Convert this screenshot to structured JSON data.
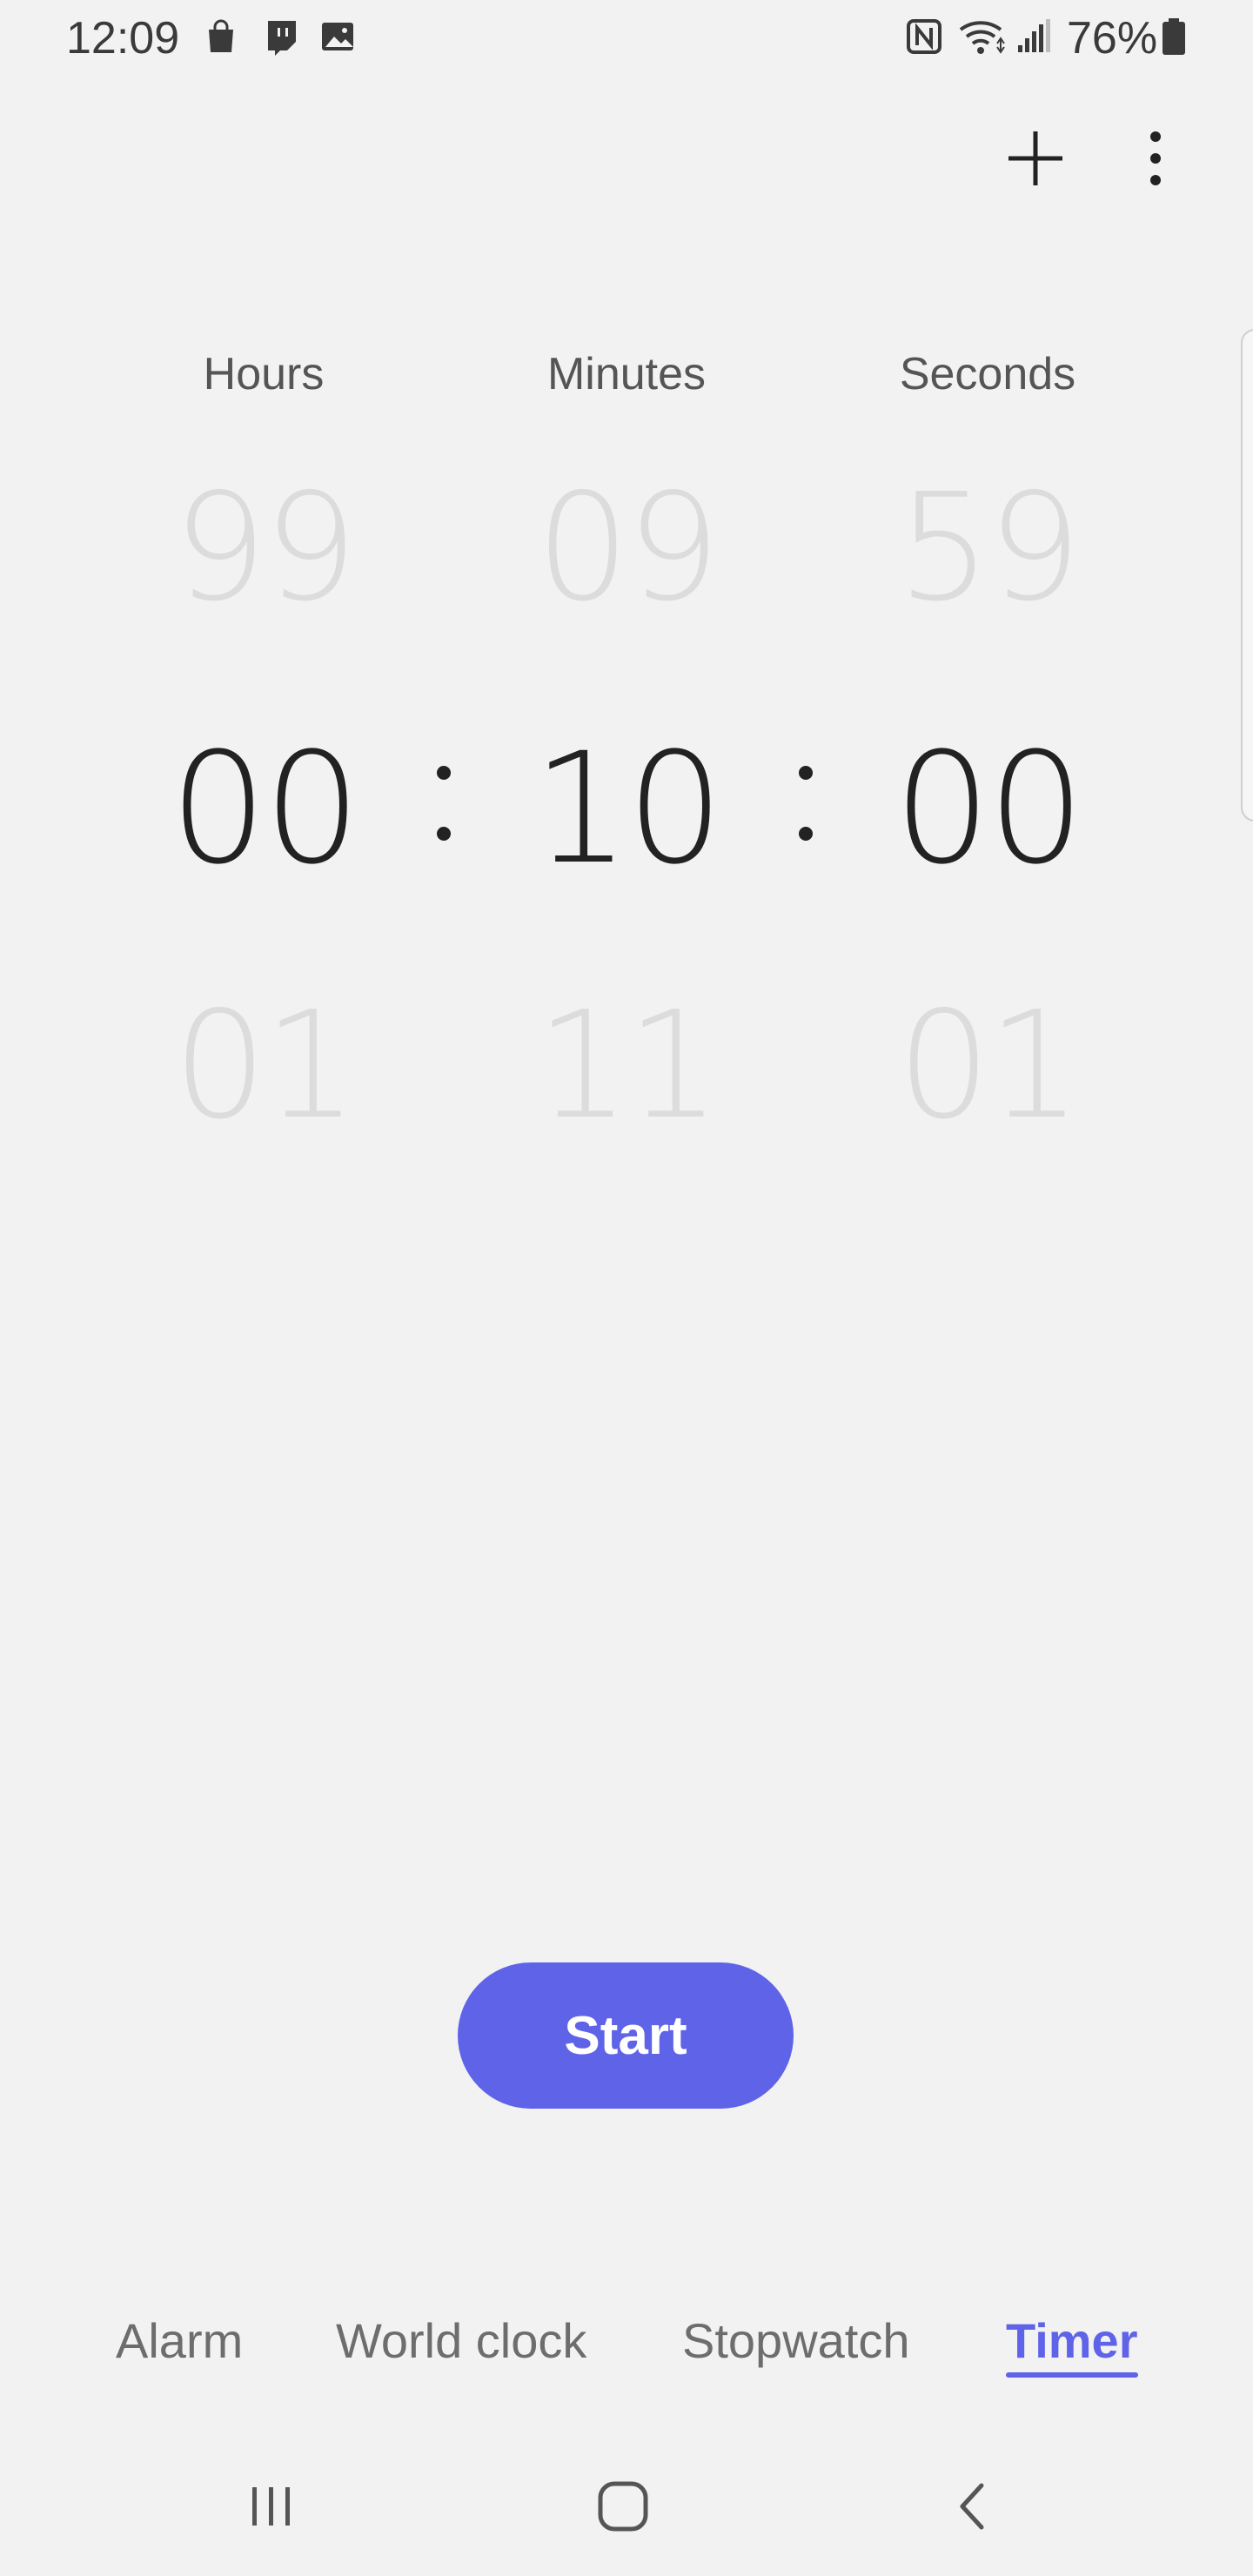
{
  "status_bar": {
    "time": "12:09",
    "battery": "76%",
    "icons": [
      "shopping-bag-icon",
      "twitch-icon",
      "image-icon",
      "nfc-icon",
      "wifi-icon",
      "signal-icon",
      "battery-icon"
    ]
  },
  "toolbar": {
    "add_icon": "plus-icon",
    "more_icon": "more-vertical-icon"
  },
  "picker": {
    "labels": {
      "hours": "Hours",
      "minutes": "Minutes",
      "seconds": "Seconds"
    },
    "hours": {
      "prev": "99",
      "current": "00",
      "next": "01"
    },
    "minutes": {
      "prev": "09",
      "current": "10",
      "next": "11"
    },
    "seconds": {
      "prev": "59",
      "current": "00",
      "next": "01"
    }
  },
  "start_button": {
    "label": "Start"
  },
  "tabs": [
    {
      "label": "Alarm",
      "active": false
    },
    {
      "label": "World clock",
      "active": false
    },
    {
      "label": "Stopwatch",
      "active": false
    },
    {
      "label": "Timer",
      "active": true
    }
  ],
  "nav_bar": {
    "icons": [
      "recent-apps-icon",
      "home-icon",
      "back-icon"
    ]
  },
  "colors": {
    "accent": "#5e63e8",
    "background": "#f2f2f2",
    "text_primary": "#222222",
    "text_faded": "#dcdcdc"
  }
}
